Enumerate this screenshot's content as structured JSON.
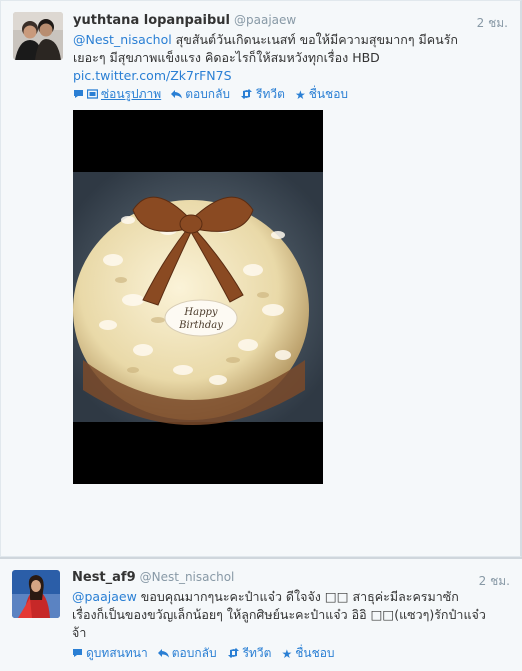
{
  "tweets": [
    {
      "name": "yuthtana lopanpaibul",
      "handle": "@paajaew",
      "time": "2 ชม.",
      "mention": "@Nest_nisachol",
      "text_line1_rest": " สุขสันต์วันเกิดนะเนสท์ ขอให้มีความสุขมากๆ มีคนรัก",
      "text_line2": "เยอะๆ มีสุขภาพแข็งแรง คิดอะไรก็ให้สมหวังทุกเรื่อง HBD",
      "pic_link": "pic.twitter.com/Zk7rFN7S",
      "actions": {
        "hide_photo": "ซ่อนรูปภาพ",
        "reply": "ตอบกลับ",
        "retweet": "รีทวีต",
        "favorite": "ชื่นชอบ"
      },
      "image": {
        "plaque_line1": "Happy",
        "plaque_line2": "Birthday"
      }
    },
    {
      "name": "Nest_af9",
      "handle": "@Nest_nisachol",
      "time": "2 ชม.",
      "mention": "@paajaew",
      "text_line1_rest": " ขอบคุณมากๆนะคะป๋าแจ๋ว ดีใจจัง □□ สาธุค่ะมีละครมาซัก",
      "text_line2": "เรื่องก็เป็นของขวัญเล็กน้อยๆ ให้ลูกศิษย์นะคะป๋าแจ๋ว อิอิ □□(แซวๆ)รักป๋าแจ๋ว",
      "text_line3": "จ้า",
      "actions": {
        "view_conversation": "ดูบทสนทนา",
        "reply": "ตอบกลับ",
        "retweet": "รีทวีต",
        "favorite": "ชื่นชอบ"
      }
    }
  ],
  "colors": {
    "link": "#2a7fd4",
    "muted": "#8899a6",
    "background": "#f5f8fa"
  },
  "icons": [
    "photo-icon",
    "reply-icon",
    "retweet-icon",
    "star-icon",
    "conversation-icon"
  ]
}
